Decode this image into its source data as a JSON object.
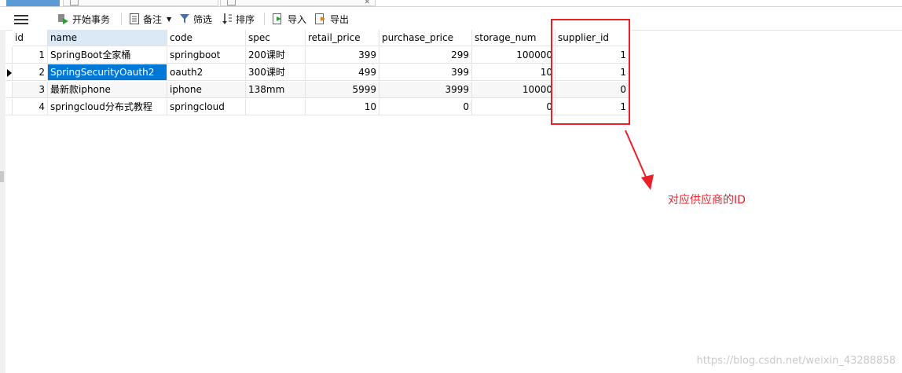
{
  "toolbar": {
    "begin_transaction": "开始事务",
    "note": "备注",
    "filter": "筛选",
    "sort": "排序",
    "import": "导入",
    "export": "导出"
  },
  "table": {
    "columns": [
      "id",
      "name",
      "code",
      "spec",
      "retail_price",
      "purchase_price",
      "storage_num",
      "supplier_id"
    ],
    "rows": [
      {
        "id": "1",
        "name": "SpringBoot全家桶",
        "code": "springboot",
        "spec": "200课时",
        "retail_price": "399",
        "purchase_price": "299",
        "storage_num": "100000",
        "supplier_id": "1"
      },
      {
        "id": "2",
        "name": "SpringSecurityOauth2",
        "code": "oauth2",
        "spec": "300课时",
        "retail_price": "499",
        "purchase_price": "399",
        "storage_num": "10",
        "supplier_id": "1"
      },
      {
        "id": "3",
        "name": "最新款iphone",
        "code": "iphone",
        "spec": "138mm",
        "retail_price": "5999",
        "purchase_price": "3999",
        "storage_num": "10000",
        "supplier_id": "0"
      },
      {
        "id": "4",
        "name": "springcloud分布式教程",
        "code": "springcloud",
        "spec": "",
        "retail_price": "10",
        "purchase_price": "0",
        "storage_num": "0",
        "supplier_id": "1"
      }
    ]
  },
  "annotation": {
    "text": "对应供应商的ID",
    "color": "#e8202a"
  },
  "watermark": "https://blog.csdn.net/weixin_43288858"
}
